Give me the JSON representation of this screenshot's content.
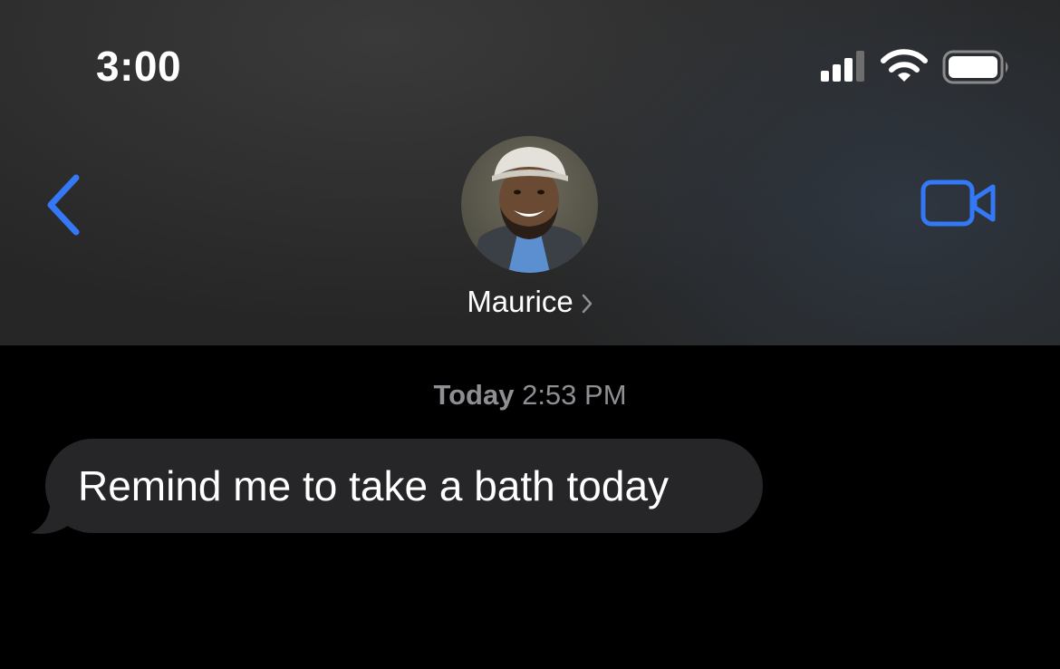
{
  "status_bar": {
    "time": "3:00",
    "signal_icon": "cellular-signal-icon",
    "wifi_icon": "wifi-icon",
    "battery_icon": "battery-icon"
  },
  "header": {
    "back_icon": "chevron-left-icon",
    "contact_name": "Maurice",
    "contact_chevron_icon": "chevron-right-icon",
    "video_icon": "video-camera-icon",
    "accent_color": "#3478f6"
  },
  "conversation": {
    "timestamp_day": "Today",
    "timestamp_time": "2:53 PM",
    "messages": [
      {
        "direction": "incoming",
        "text": "Remind me to take a bath today"
      }
    ]
  },
  "colors": {
    "background": "#000000",
    "header_background": "#262626",
    "incoming_bubble": "#262628",
    "timestamp_text": "#8e8e93"
  }
}
